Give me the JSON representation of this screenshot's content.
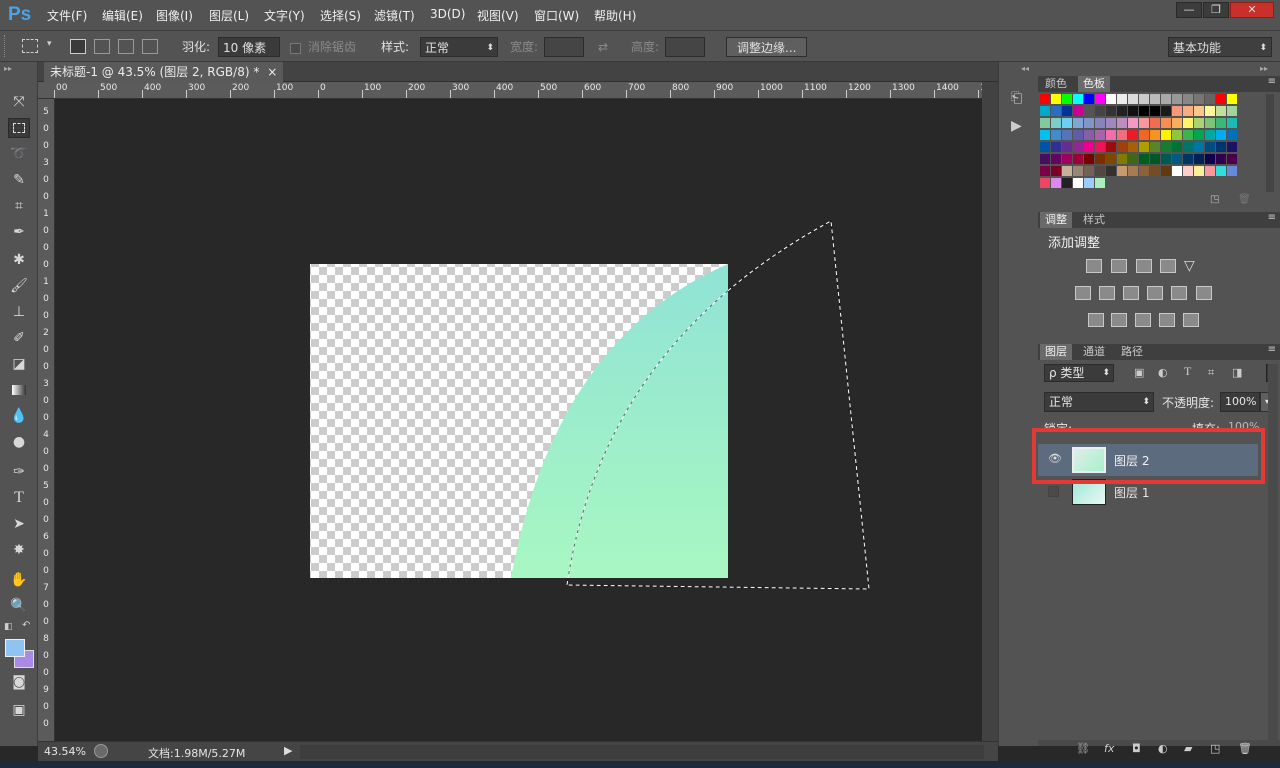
{
  "app": {
    "logo": "Ps"
  },
  "menu": [
    "文件(F)",
    "编辑(E)",
    "图像(I)",
    "图层(L)",
    "文字(Y)",
    "选择(S)",
    "滤镜(T)",
    "3D(D)",
    "视图(V)",
    "窗口(W)",
    "帮助(H)"
  ],
  "window_buttons": {
    "minimize": "—",
    "restore": "❐",
    "close": "✕"
  },
  "options": {
    "feather_label": "羽化:",
    "feather_value": "10 像素",
    "antialias_label": "消除锯齿",
    "style_label": "样式:",
    "style_value": "正常",
    "width_label": "宽度:",
    "height_label": "高度:",
    "refine_edge": "调整边缘...",
    "workspace": "基本功能"
  },
  "document": {
    "tab_title": "未标题-1 @ 43.5% (图层 2, RGB/8) *",
    "tab_close": "×"
  },
  "ruler_h": [
    "00",
    "500",
    "400",
    "300",
    "200",
    "100",
    "0",
    "100",
    "200",
    "300",
    "400",
    "500",
    "600",
    "700",
    "800",
    "900",
    "1000",
    "1100",
    "1200",
    "1300",
    "1400",
    "150"
  ],
  "ruler_v": [
    "5",
    "0",
    "0",
    "3",
    "0",
    "0",
    "1",
    "0",
    "0",
    "0",
    "1",
    "0",
    "0",
    "2",
    "0",
    "0",
    "3",
    "0",
    "0",
    "4",
    "0",
    "0",
    "5",
    "0",
    "0",
    "6",
    "0",
    "0",
    "7",
    "0",
    "0",
    "8",
    "0",
    "0",
    "9",
    "0",
    "0"
  ],
  "status": {
    "zoom": "43.54%",
    "doc_info": "文档:1.98M/5.27M"
  },
  "panels": {
    "color_tabs": [
      "颜色",
      "色板"
    ],
    "adjust_tabs": [
      "调整",
      "样式"
    ],
    "add_adjustment": "添加调整",
    "layers_tabs": [
      "图层",
      "通道",
      "路径"
    ],
    "kind_filter": "ρ 类型",
    "blend_mode": "正常",
    "opacity_label": "不透明度:",
    "opacity_value": "100%",
    "lock_label": "锁定:",
    "fill_label": "填充:",
    "fill_value": "100%",
    "layers": [
      {
        "name": "图层 2",
        "selected": true,
        "visible": true
      },
      {
        "name": "图层 1",
        "selected": false,
        "visible": false
      }
    ]
  },
  "colors": {
    "accent_highlight": "#e53935",
    "canvas_grad_top": "#90e3d5",
    "canvas_grad_bottom": "#a8f7c2"
  },
  "swatches": [
    "#ff0000",
    "#ffff00",
    "#00ff00",
    "#00ffff",
    "#0000ff",
    "#ff00ff",
    "#ffffff",
    "#ececec",
    "#dcdcdc",
    "#cbcbcb",
    "#bababa",
    "#a9a9a9",
    "#989898",
    "#878787",
    "#767676",
    "#656565",
    "#ff0000",
    "#ffff00",
    "#00aacc",
    "#2a6ec2",
    "#003399",
    "#cc0099",
    "#545454",
    "#444444",
    "#333333",
    "#222222",
    "#111111",
    "#000000",
    "#000000",
    "#1a1a1a",
    "#f7977a",
    "#f9ad81",
    "#fdc68a",
    "#fff79a",
    "#c4df9b",
    "#a2d39c",
    "#82ca9d",
    "#7bcdc8",
    "#6ecff6",
    "#7ea7d8",
    "#8493ca",
    "#8882be",
    "#a187be",
    "#bc8dbf",
    "#f49ac2",
    "#f6989d",
    "#f26c4f",
    "#f68e55",
    "#fbaf5c",
    "#fff467",
    "#acd372",
    "#7cc576",
    "#3bb878",
    "#1abbb4",
    "#00bff3",
    "#438ccb",
    "#5574b9",
    "#605ca8",
    "#855fa8",
    "#a763a8",
    "#f06eaa",
    "#f26d7d",
    "#ed1c24",
    "#f26522",
    "#f7941d",
    "#fff200",
    "#8dc73f",
    "#39b54a",
    "#00a651",
    "#00a99d",
    "#00aeef",
    "#0072bc",
    "#0054a6",
    "#2e3192",
    "#662d91",
    "#92278f",
    "#ec008c",
    "#ed145b",
    "#9e0b0f",
    "#a0410d",
    "#a36209",
    "#aba000",
    "#598527",
    "#197b30",
    "#007236",
    "#00746b",
    "#0076a3",
    "#004b80",
    "#003471",
    "#1b1464",
    "#440e62",
    "#630460",
    "#9e005d",
    "#9e0039",
    "#790000",
    "#7b2e00",
    "#7d4900",
    "#827b00",
    "#406618",
    "#005e20",
    "#005826",
    "#005952",
    "#005b7f",
    "#003663",
    "#002157",
    "#0d004c",
    "#32004b",
    "#4b0049",
    "#7b0046",
    "#7a0026",
    "#c7b299",
    "#998675",
    "#736357",
    "#534741",
    "#37302d",
    "#c69c6d",
    "#a67c52",
    "#8c6239",
    "#754c24",
    "#603913",
    "#ffffff",
    "#ffcccc",
    "#ffee99",
    "#f6989d",
    "#33dddd",
    "#6688dd",
    "#ee4466",
    "#dd88ee",
    "#222222",
    "#ffffff",
    "#99ccff",
    "#aaeebb"
  ]
}
